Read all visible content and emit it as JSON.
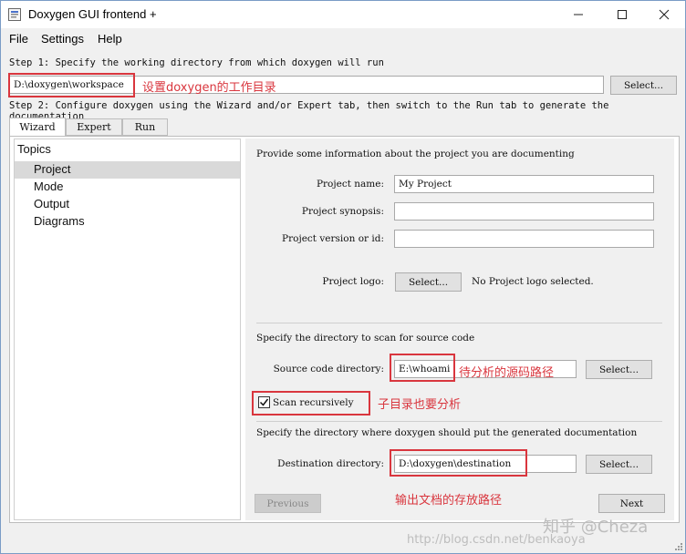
{
  "window": {
    "title": "Doxygen GUI frontend +",
    "minimize_icon": "minimize-icon",
    "maximize_icon": "maximize-icon",
    "close_icon": "close-icon"
  },
  "menu": [
    "File",
    "Settings",
    "Help"
  ],
  "step1": {
    "text": "Step 1: Specify the working directory from which doxygen will run",
    "value": "D:\\doxygen\\workspace",
    "select_label": "Select..."
  },
  "step2": {
    "text": "Step 2: Configure doxygen using the Wizard and/or Expert tab, then switch to the Run tab to generate the documentation"
  },
  "tabs": [
    "Wizard",
    "Expert",
    "Run"
  ],
  "topics": {
    "title": "Topics",
    "items": [
      "Project",
      "Mode",
      "Output",
      "Diagrams"
    ]
  },
  "project": {
    "intro": "Provide some information about the project you are documenting",
    "name_label": "Project name:",
    "name_value": "My Project",
    "synopsis_label": "Project synopsis:",
    "synopsis_value": "",
    "version_label": "Project version or id:",
    "version_value": "",
    "logo_label": "Project logo:",
    "logo_button": "Select...",
    "logo_status": "No Project logo selected."
  },
  "source": {
    "intro": "Specify the directory to scan for source code",
    "dir_label": "Source code directory:",
    "dir_value": "E:\\whoami",
    "select_label": "Select...",
    "scan_label": "Scan recursively",
    "scan_checked": true
  },
  "destination": {
    "intro": "Specify the directory where doxygen should put the generated documentation",
    "dir_label": "Destination directory:",
    "dir_value": "D:\\doxygen\\destination",
    "select_label": "Select..."
  },
  "nav": {
    "previous": "Previous",
    "next": "Next"
  },
  "annotations": {
    "workdir": "设置doxygen的工作目录",
    "source": "待分析的源码路径",
    "recursive": "子目录也要分析",
    "destination": "输出文档的存放路径",
    "color": "#d9363e"
  },
  "watermark": {
    "brand": "知乎 @Cheza",
    "url": "http://blog.csdn.net/benkaoya"
  }
}
